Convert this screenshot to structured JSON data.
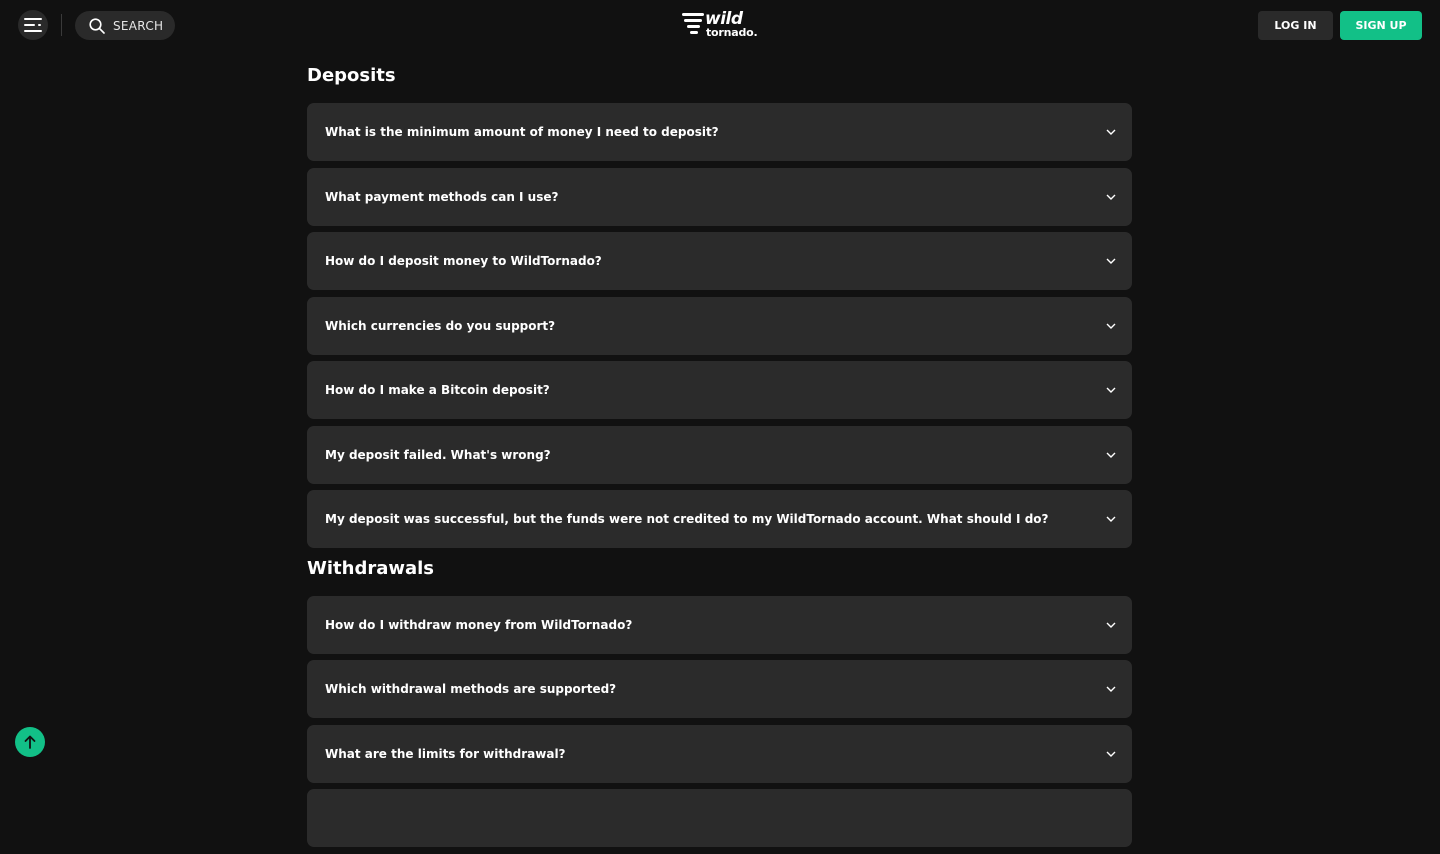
{
  "header": {
    "search_label": "SEARCH",
    "logo_top": "wild",
    "logo_bottom": "tornado.",
    "login_label": "LOG IN",
    "signup_label": "SIGN UP"
  },
  "deposits": {
    "title": "Deposits",
    "questions": [
      "What is the minimum amount of money I need to deposit?",
      "What payment methods can I use?",
      "How do I deposit money to WildTornado?",
      "Which currencies do you support?",
      "How do I make a Bitcoin deposit?",
      "My deposit failed. What's wrong?",
      "My deposit was successful, but the funds were not credited to my WildTornado account. What should I do?"
    ]
  },
  "withdrawals": {
    "title": "Withdrawals",
    "questions": [
      "How do I withdraw money from WildTornado?",
      "Which withdrawal methods are supported?",
      "What are the limits for withdrawal?",
      ""
    ]
  },
  "colors": {
    "background": "#111111",
    "card": "#2b2b2b",
    "accent": "#12c087"
  },
  "icons": {
    "menu": "menu-icon",
    "search": "search-icon",
    "chevron": "chevron-down-icon",
    "scroll_top": "arrow-up-icon"
  }
}
